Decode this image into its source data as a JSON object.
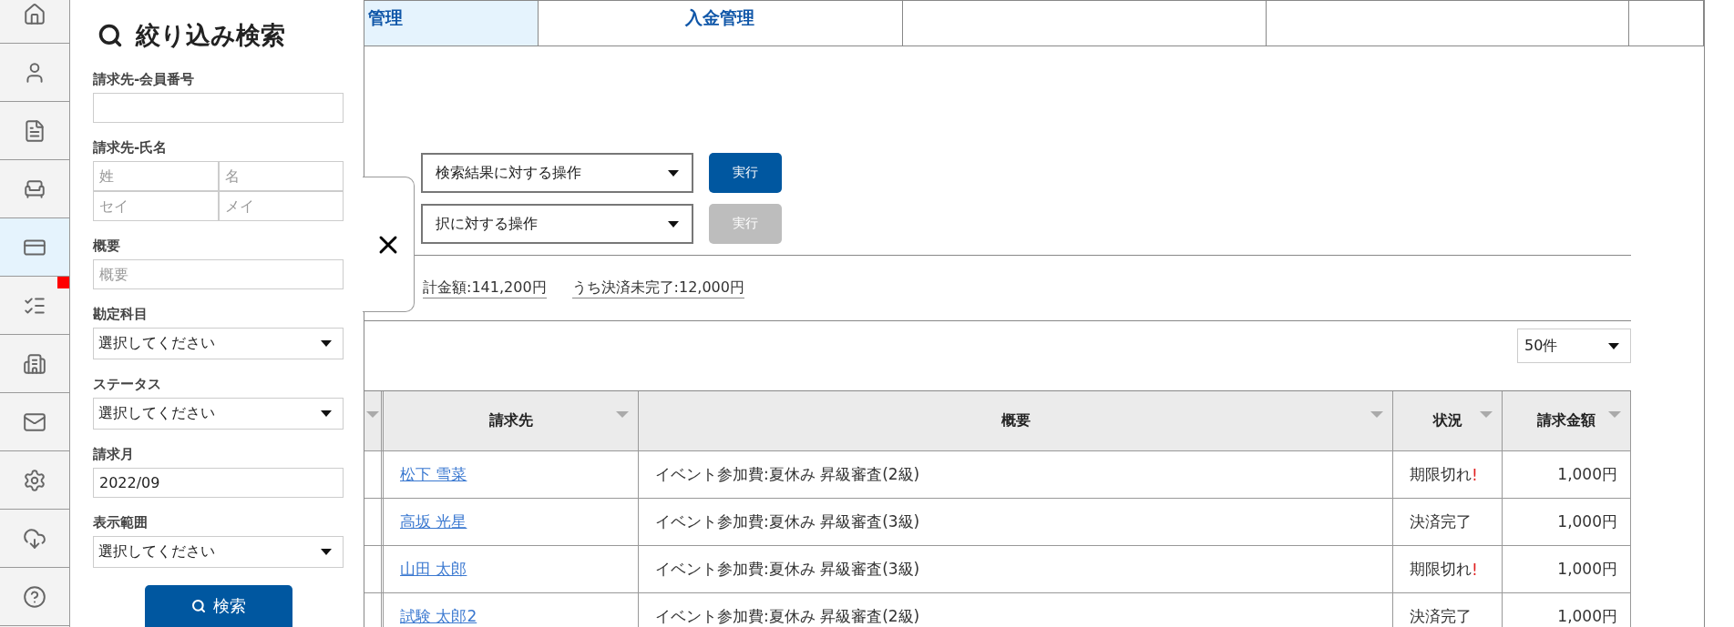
{
  "rail": [
    {
      "selected": false,
      "alert": false
    },
    {
      "selected": false,
      "alert": false
    },
    {
      "selected": false,
      "alert": false
    },
    {
      "selected": false,
      "alert": false
    },
    {
      "selected": true,
      "alert": false
    },
    {
      "selected": false,
      "alert": true
    },
    {
      "selected": false,
      "alert": false
    },
    {
      "selected": false,
      "alert": false
    },
    {
      "selected": false,
      "alert": false
    },
    {
      "selected": false,
      "alert": false
    },
    {
      "selected": false,
      "alert": false
    }
  ],
  "filter_panel": {
    "title": "絞り込み検索",
    "fields": [
      {
        "kind": "text",
        "label": "請求先-会員番号"
      },
      {
        "kind": "pair",
        "label": "請求先-氏名",
        "inputs": [
          {
            "placeholder": "姓"
          },
          {
            "placeholder": "名"
          },
          {
            "placeholder": "セイ"
          },
          {
            "placeholder": "メイ"
          }
        ]
      },
      {
        "kind": "text",
        "label": "概要",
        "placeholder": "概要"
      },
      {
        "kind": "select",
        "label": "勘定科目",
        "value": "選択してください"
      },
      {
        "kind": "select",
        "label": "ステータス",
        "value": "選択してください"
      },
      {
        "kind": "text",
        "label": "請求月",
        "value": "2022/09"
      },
      {
        "kind": "select",
        "label": "表示範囲",
        "value": "選択してください"
      }
    ],
    "search_button": "検索"
  },
  "tabs": [
    {
      "label": "管理",
      "selected": true
    },
    {
      "label": "入金管理",
      "selected": false
    }
  ],
  "bulk_actions": [
    {
      "select": "検索結果に対する操作",
      "button": "実行",
      "disabled": false
    },
    {
      "select": "択に対する操作",
      "button": "実行",
      "disabled": true
    }
  ],
  "totals": [
    "計金額:141,200円",
    "うち決済未完了:12,000円"
  ],
  "page_size": "50件",
  "table": {
    "columns": [
      "請求先",
      "概要",
      "状況",
      "請求金額"
    ],
    "rows": [
      {
        "payer": "松下 雪菜",
        "summary": "イベント参加費:夏休み 昇級審査(2級)",
        "status": "期限切れ",
        "status_mark": "!",
        "amount": "1,000円"
      },
      {
        "payer": "高坂 光星",
        "summary": "イベント参加費:夏休み 昇級審査(3級)",
        "status": "決済完了",
        "amount": "1,000円"
      },
      {
        "payer": "山田 太郎",
        "summary": "イベント参加費:夏休み 昇級審査(3級)",
        "status": "期限切れ",
        "status_mark": "!",
        "amount": "1,000円"
      },
      {
        "payer": "試験 太郎2",
        "summary": "イベント参加費:夏休み 昇級審査(2級)",
        "status": "決済完了",
        "amount": "1,000円"
      }
    ]
  }
}
